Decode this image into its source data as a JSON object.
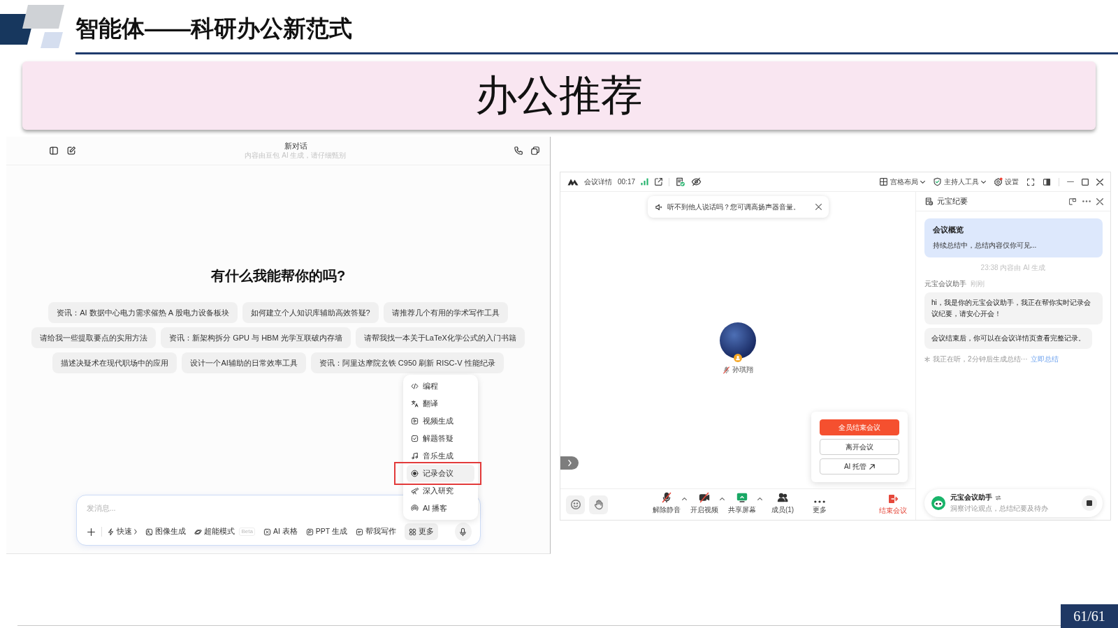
{
  "header": {
    "title": "智能体——科研办公新范式"
  },
  "banner": {
    "title": "办公推荐"
  },
  "chat_app": {
    "title": "新对话",
    "subtitle": "内容由豆包 AI 生成，请仔细甄别",
    "greeting": "有什么我能帮你的吗?",
    "suggestion_rows": [
      [
        "资讯：AI 数据中心电力需求催热 A 股电力设备板块",
        "如何建立个人知识库辅助高效答疑?",
        "请推荐几个有用的学术写作工具"
      ],
      [
        "请给我一些提取要点的实用方法",
        "资讯：新架构拆分 GPU 与 HBM 光学互联破内存墙",
        "请帮我找一本关于LaTeX化学公式的入门书籍"
      ],
      [
        "描述决疑术在现代职场中的应用",
        "设计一个AI辅助的日常效率工具",
        "资讯：阿里达摩院玄铁 C950 刷新 RISC-V 性能纪录"
      ]
    ],
    "input": {
      "placeholder": "发消息..."
    },
    "tools": [
      {
        "label": "快速",
        "kind": "speed",
        "has_menu": true,
        "selected": false
      },
      {
        "label": "图像生成",
        "kind": "image",
        "has_menu": false,
        "selected": false
      },
      {
        "label": "超能模式",
        "kind": "super",
        "badge": "Beta",
        "has_menu": false,
        "selected": false
      },
      {
        "label": "AI 表格",
        "kind": "sheet",
        "has_menu": false,
        "selected": false
      },
      {
        "label": "PPT 生成",
        "kind": "ppt",
        "has_menu": false,
        "selected": false
      },
      {
        "label": "帮我写作",
        "kind": "write",
        "has_menu": false,
        "selected": false
      },
      {
        "label": "更多",
        "kind": "more",
        "has_menu": false,
        "selected": true
      }
    ],
    "more_menu": [
      {
        "label": "编程",
        "selected": false
      },
      {
        "label": "翻译",
        "selected": false
      },
      {
        "label": "视频生成",
        "selected": false
      },
      {
        "label": "解题答疑",
        "selected": false
      },
      {
        "label": "音乐生成",
        "selected": false
      },
      {
        "label": "记录会议",
        "selected": true
      },
      {
        "label": "深入研究",
        "selected": false
      },
      {
        "label": "AI 播客",
        "selected": false
      }
    ]
  },
  "meeting_app": {
    "title": "会议详情",
    "timer": "00:17",
    "top_tools": [
      {
        "label": "宫格布局",
        "kind": "layout",
        "has_menu": true
      },
      {
        "label": "主持人工具",
        "kind": "host",
        "has_menu": true
      },
      {
        "label": "设置",
        "kind": "settings",
        "has_menu": false
      }
    ],
    "toast": {
      "text": "听不到他人说话吗？您可调高扬声器音量。"
    },
    "participant": {
      "name": "孙琪翔",
      "muted": true
    },
    "end_menu": [
      {
        "label": "全员结束会议",
        "kind": "danger"
      },
      {
        "label": "离开会议",
        "kind": "plain"
      },
      {
        "label": "AI 托管",
        "kind": "external"
      }
    ],
    "media_controls": [
      {
        "label": "解除静音",
        "kind": "mic",
        "on": false,
        "has_menu": true
      },
      {
        "label": "开启视频",
        "kind": "video",
        "on": false,
        "has_menu": true
      }
    ],
    "controls": [
      {
        "label": "共享屏幕",
        "kind": "share",
        "has_menu": true
      },
      {
        "label": "成员(1)",
        "kind": "members",
        "has_menu": false
      },
      {
        "label": "更多",
        "kind": "more",
        "has_menu": false
      }
    ],
    "end_button": {
      "label": "结束会议"
    },
    "notes_panel": {
      "title": "元宝纪要",
      "summary_title": "会议概览",
      "summary_text": "持续总结中，总结内容仅你可见...",
      "timestamp": "23:38 内容由 AI 生成",
      "sender": "元宝会议助手",
      "sender_time": "刚刚",
      "messages": [
        "hi，我是你的元宝会议助手，我正在帮你实时记录会议纪要，请安心开会！",
        "会议结束后，你可以在会议详情页查看完整记录。"
      ],
      "status": "我正在听，2分钟后生成总结···",
      "status_link": "立即总结"
    },
    "assistant_bar": {
      "name": "元宝会议助手",
      "description": "洞察讨论观点，总结纪要及待办"
    }
  },
  "footer": {
    "page": "61/61"
  }
}
